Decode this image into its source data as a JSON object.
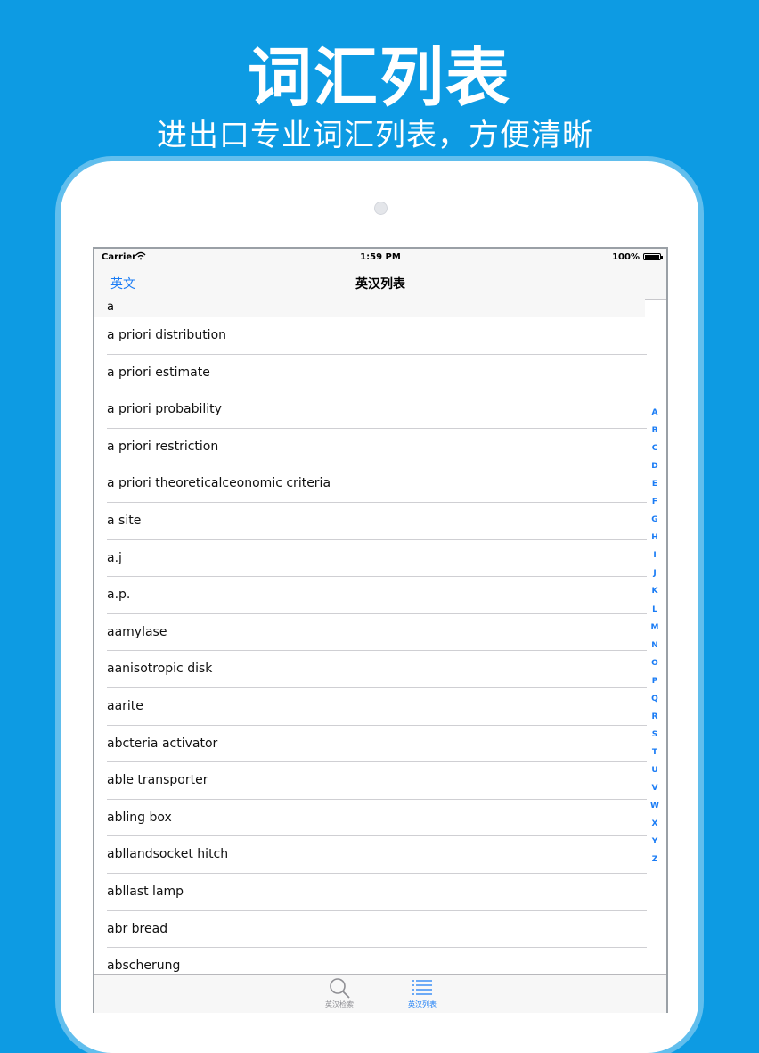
{
  "promo": {
    "headline": "词汇列表",
    "subline": "进出口专业词汇列表，方便清晰"
  },
  "status_bar": {
    "carrier": "Carrier",
    "time": "1:59 PM",
    "battery": "100%"
  },
  "nav": {
    "left_button": "英文",
    "title": "英汉列表"
  },
  "section": {
    "header": "a"
  },
  "entries": [
    "a priori distribution",
    "a priori estimate",
    "a priori probability",
    "a priori restriction",
    "a priori theoreticalceonomic criteria",
    "a site",
    "a.j",
    "a.p.",
    "aamylase",
    "aanisotropic disk",
    "aarite",
    "abcteria activator",
    "able transporter",
    "abling box",
    "abllandsocket hitch",
    "abllast lamp",
    "abr bread",
    "abscherung"
  ],
  "index_letters": [
    "A",
    "B",
    "C",
    "D",
    "E",
    "F",
    "G",
    "H",
    "I",
    "J",
    "K",
    "L",
    "M",
    "N",
    "O",
    "P",
    "Q",
    "R",
    "S",
    "T",
    "U",
    "V",
    "W",
    "X",
    "Y",
    "Z"
  ],
  "tabs": [
    {
      "label": "英汉检索",
      "icon": "magnifier-icon"
    },
    {
      "label": "英汉列表",
      "icon": "list-icon"
    }
  ],
  "colors": {
    "background": "#0d9be3",
    "accent": "#1a7cf5"
  }
}
